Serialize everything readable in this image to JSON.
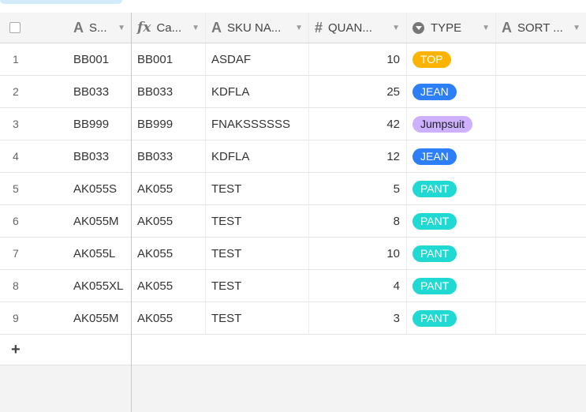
{
  "columns": [
    {
      "label": "S...",
      "icon": "text-field-icon"
    },
    {
      "label": "Ca...",
      "icon": "formula-icon"
    },
    {
      "label": "SKU NA...",
      "icon": "text-field-icon"
    },
    {
      "label": "QUAN...",
      "icon": "number-icon"
    },
    {
      "label": "TYPE",
      "icon": "single-select-icon"
    },
    {
      "label": "SORT ...",
      "icon": "text-field-icon"
    }
  ],
  "rows": [
    {
      "num": "1",
      "s": "BB001",
      "ca": "BB001",
      "sku": "ASDAF",
      "qty": "10",
      "type": "TOP",
      "sort": ""
    },
    {
      "num": "2",
      "s": "BB033",
      "ca": "BB033",
      "sku": "KDFLA",
      "qty": "25",
      "type": "JEAN",
      "sort": ""
    },
    {
      "num": "3",
      "s": "BB999",
      "ca": "BB999",
      "sku": "FNAKSSSSSS",
      "qty": "42",
      "type": "Jumpsuit",
      "sort": ""
    },
    {
      "num": "4",
      "s": "BB033",
      "ca": "BB033",
      "sku": "KDFLA",
      "qty": "12",
      "type": "JEAN",
      "sort": ""
    },
    {
      "num": "5",
      "s": "AK055S",
      "ca": "AK055",
      "sku": "TEST",
      "qty": "5",
      "type": "PANT",
      "sort": ""
    },
    {
      "num": "6",
      "s": "AK055M",
      "ca": "AK055",
      "sku": "TEST",
      "qty": "8",
      "type": "PANT",
      "sort": ""
    },
    {
      "num": "7",
      "s": "AK055L",
      "ca": "AK055",
      "sku": "TEST",
      "qty": "10",
      "type": "PANT",
      "sort": ""
    },
    {
      "num": "8",
      "s": "AK055XL",
      "ca": "AK055",
      "sku": "TEST",
      "qty": "4",
      "type": "PANT",
      "sort": ""
    },
    {
      "num": "9",
      "s": "AK055M",
      "ca": "AK055",
      "sku": "TEST",
      "qty": "3",
      "type": "PANT",
      "sort": ""
    }
  ],
  "type_colors": {
    "TOP": {
      "bg": "#fcb400",
      "fg": "#ffffff"
    },
    "JEAN": {
      "bg": "#2d7ff9",
      "fg": "#ffffff"
    },
    "Jumpsuit": {
      "bg": "#cdb0ff",
      "fg": "#1f1f1f"
    },
    "PANT": {
      "bg": "#20d9d2",
      "fg": "#ffffff"
    }
  },
  "add_row_label": "+"
}
